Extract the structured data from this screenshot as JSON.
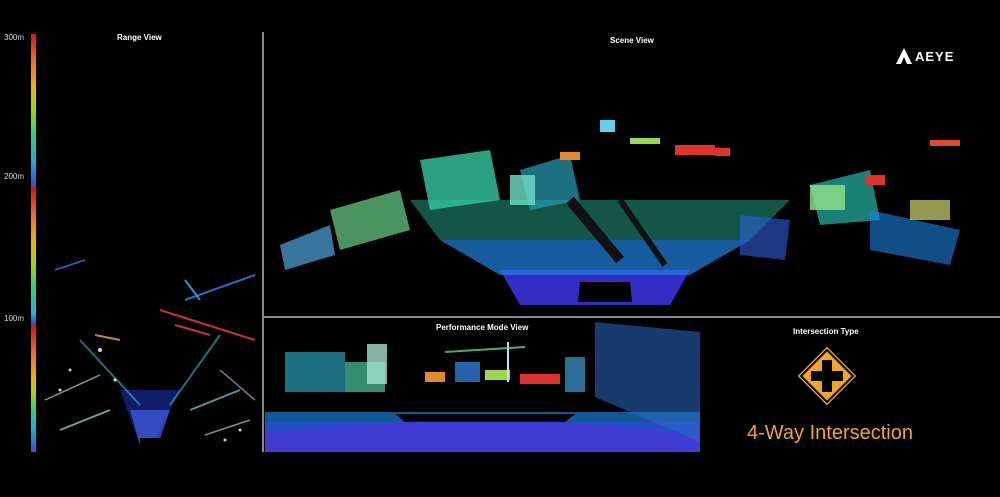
{
  "panels": {
    "range_view": {
      "title": "Range View"
    },
    "scene_view": {
      "title": "Scene View"
    },
    "performance_view": {
      "title": "Performance Mode View"
    },
    "intersection": {
      "title": "Intersection Type",
      "value": "4-Way Intersection"
    }
  },
  "scale": {
    "labels": [
      "300m",
      "200m",
      "100m"
    ]
  },
  "brand": {
    "name": "AEYE"
  },
  "colors": {
    "background": "#000000",
    "divider": "#8a8a8a",
    "sign_fill": "#f2a81d",
    "label_accent": "#f2a81d"
  },
  "icons": {
    "sign": "four-way-intersection-sign-icon",
    "logo": "aeye-logo-icon"
  }
}
